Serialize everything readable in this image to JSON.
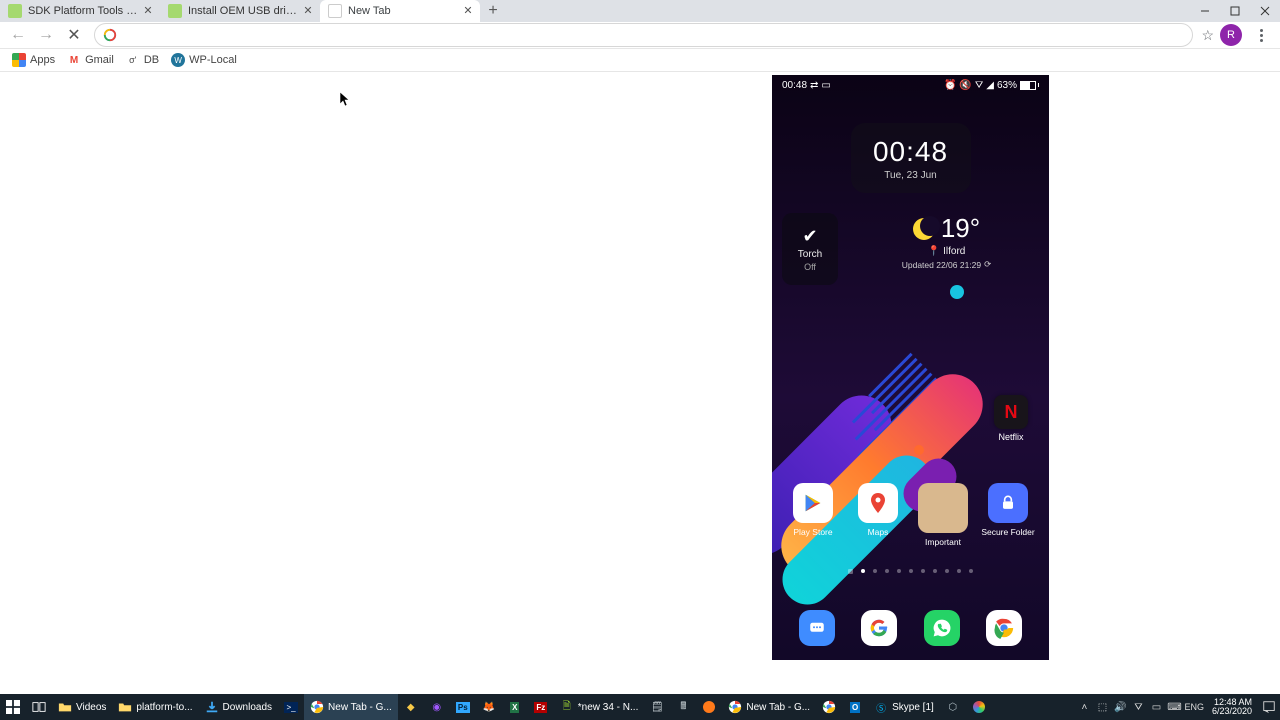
{
  "browser": {
    "tabs": [
      {
        "title": "SDK Platform Tools release notes",
        "icon": "android"
      },
      {
        "title": "Install OEM USB drivers | Android",
        "icon": "android"
      },
      {
        "title": "New Tab",
        "icon": "blank",
        "active": true
      }
    ],
    "window_controls": {
      "min": "—",
      "max": "❐",
      "close": "✕"
    },
    "nav": {
      "back": "←",
      "forward": "→",
      "stop": "✕"
    },
    "omnibox": {
      "value": ""
    },
    "avatar": "R",
    "bookmarks": [
      {
        "label": "Apps",
        "icon": "apps"
      },
      {
        "label": "Gmail",
        "icon": "gmail"
      },
      {
        "label": "DB",
        "icon": "db"
      },
      {
        "label": "WP-Local",
        "icon": "wp"
      }
    ]
  },
  "phone": {
    "status": {
      "time": "00:48",
      "battery": "63%"
    },
    "clock": {
      "time": "00:48",
      "date": "Tue, 23 Jun"
    },
    "torch": {
      "label": "Torch",
      "state": "Off"
    },
    "weather": {
      "temp": "19°",
      "location": "Ilford",
      "updated": "Updated 22/06 21:29"
    },
    "netflix": "Netflix",
    "apps": [
      {
        "label": "Play Store"
      },
      {
        "label": "Maps"
      },
      {
        "label": "Important"
      },
      {
        "label": "Secure Folder"
      }
    ],
    "dots": {
      "count": 11,
      "active": 1
    }
  },
  "taskbar": {
    "items": [
      {
        "label": "",
        "icon": "win"
      },
      {
        "label": "",
        "icon": "taskview"
      },
      {
        "label": "Videos",
        "icon": "folder"
      },
      {
        "label": "platform-to...",
        "icon": "folder"
      },
      {
        "label": "Downloads",
        "icon": "dl"
      },
      {
        "label": "",
        "icon": "ps"
      },
      {
        "label": "New Tab - G...",
        "icon": "chrome",
        "active": true
      },
      {
        "label": "",
        "icon": "diamond"
      },
      {
        "label": "",
        "icon": "figma"
      },
      {
        "label": "",
        "icon": "ps2"
      },
      {
        "label": "",
        "icon": "firefox"
      },
      {
        "label": "",
        "icon": "excel"
      },
      {
        "label": "",
        "icon": "fz"
      },
      {
        "label": "*new 34 - N...",
        "icon": "npp"
      },
      {
        "label": "",
        "icon": "note"
      },
      {
        "label": "",
        "icon": "calc"
      },
      {
        "label": "",
        "icon": "orange"
      },
      {
        "label": "New Tab - G...",
        "icon": "chrome"
      },
      {
        "label": "",
        "icon": "chrome"
      },
      {
        "label": "",
        "icon": "outlook"
      },
      {
        "label": "Skype [1]",
        "icon": "skype"
      },
      {
        "label": "",
        "icon": "cube"
      },
      {
        "label": "",
        "icon": "resolve"
      }
    ],
    "tray": {
      "lang": "ENG",
      "time": "12:48 AM",
      "date": "6/23/2020"
    }
  }
}
